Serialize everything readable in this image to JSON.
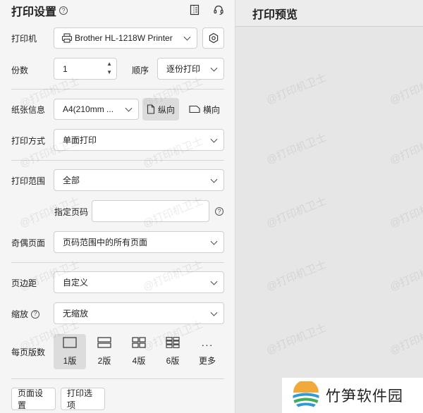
{
  "header": {
    "title": "打印设置",
    "help_glyph": "?"
  },
  "printer": {
    "label": "打印机",
    "value": "Brother HL-1218W Printer"
  },
  "copies": {
    "label": "份数",
    "value": "1",
    "up": "▲",
    "down": "▼"
  },
  "order": {
    "label": "顺序",
    "value": "逐份打印"
  },
  "paper": {
    "label": "纸张信息",
    "value": "A4(210mm ...",
    "portrait": "纵向",
    "landscape": "横向"
  },
  "print_mode": {
    "label": "打印方式",
    "value": "单面打印"
  },
  "range": {
    "label": "打印范围",
    "value": "全部",
    "pages_label": "指定页码",
    "pages_value": ""
  },
  "odd_even": {
    "label": "奇偶页面",
    "value": "页码范围中的所有页面"
  },
  "margin": {
    "label": "页边距",
    "value": "自定义"
  },
  "scale": {
    "label": "缩放",
    "value": "无缩放"
  },
  "per_page": {
    "label": "每页版数",
    "options": [
      {
        "label": "1版"
      },
      {
        "label": "2版"
      },
      {
        "label": "4版"
      },
      {
        "label": "6版"
      },
      {
        "label": "更多",
        "glyph": "···"
      }
    ]
  },
  "footer": {
    "page_setup": "页面设置",
    "print_options": "打印选项"
  },
  "preview": {
    "title": "打印预览"
  },
  "watermark": "@打印机卫士",
  "logo": {
    "text": "竹笋软件园"
  },
  "colors": {
    "accent_gray": "#dcdcdc",
    "border": "#cfcfcf",
    "panel": "#f5f5f5"
  }
}
